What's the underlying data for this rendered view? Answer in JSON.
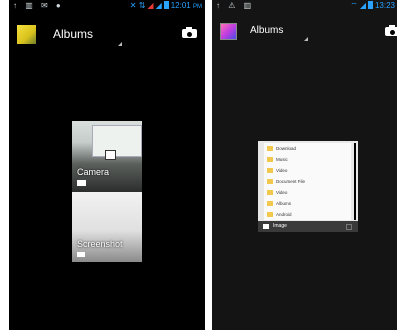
{
  "left": {
    "status_time": "12:01",
    "status_suffix": "PM",
    "title": "Albums",
    "albums": [
      {
        "name": "Camera"
      },
      {
        "name": "Screenshot"
      }
    ]
  },
  "right": {
    "status_time": "13:23",
    "title": "Albums",
    "folders": [
      "Download",
      "Music",
      "Video",
      "Document File",
      "Video",
      "Albums",
      "Android"
    ],
    "footer_label": "Image"
  },
  "colors": {
    "status_accent": "#29a3ff",
    "folder": "#f2c94c"
  }
}
